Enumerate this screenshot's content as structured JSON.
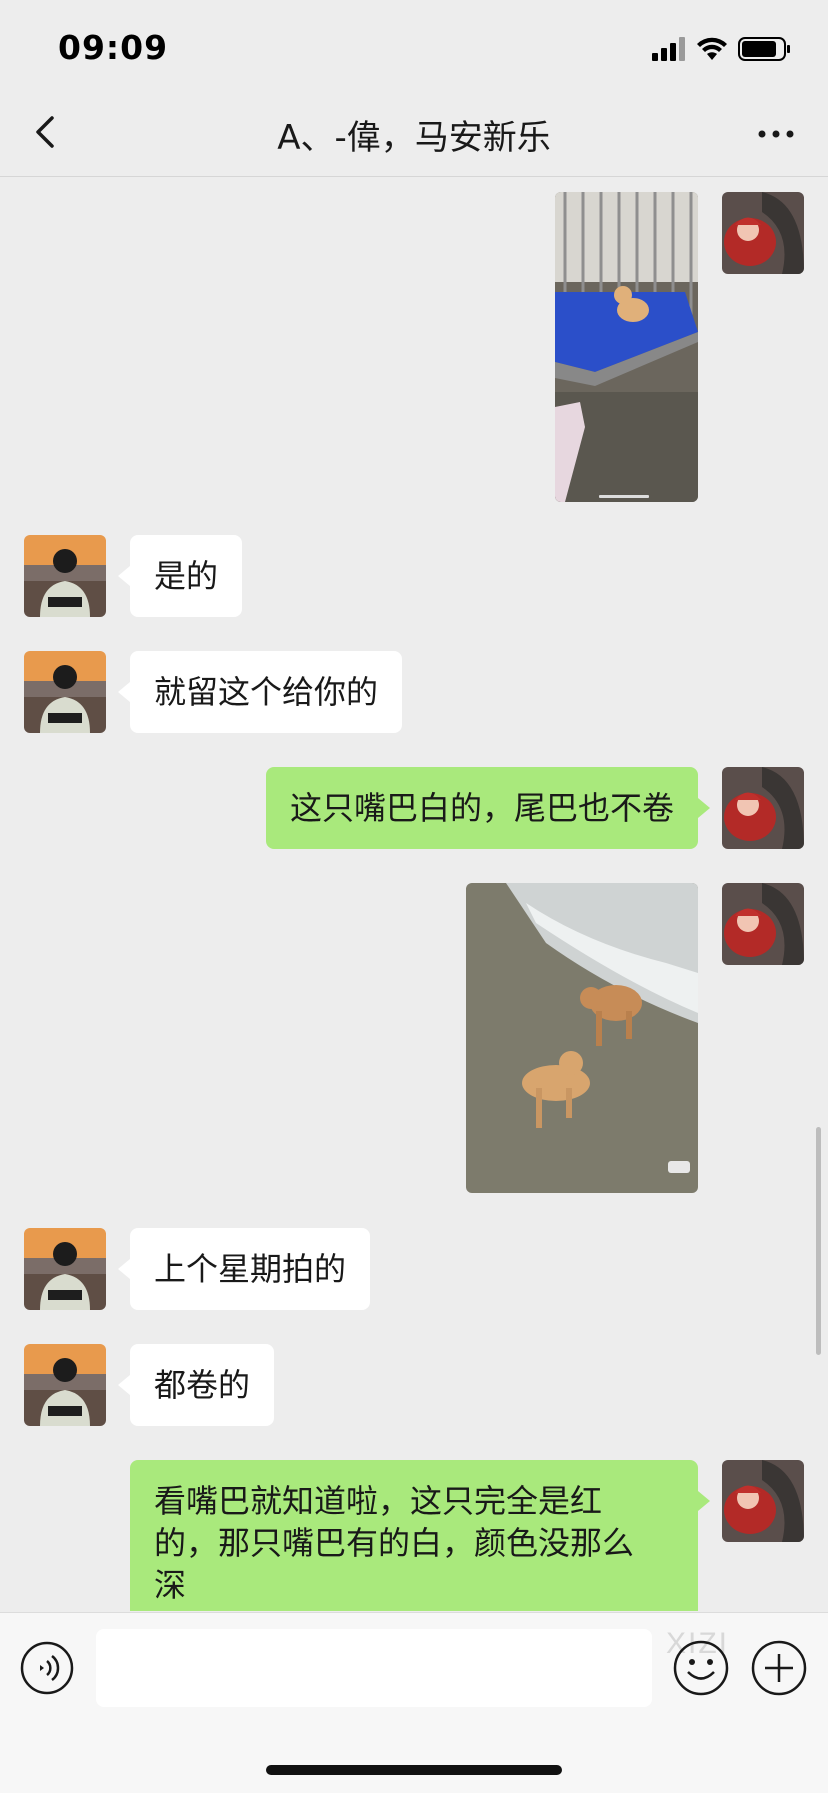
{
  "status": {
    "time": "09:09"
  },
  "nav": {
    "title": "A、-偉，马安新乐",
    "back_icon": "chevron-left-icon",
    "more_icon": "more-dots-icon"
  },
  "messages": [
    {
      "from": "me",
      "type": "image",
      "image_desc": "puppy-in-cage"
    },
    {
      "from": "them",
      "type": "text",
      "text": "是的"
    },
    {
      "from": "them",
      "type": "text",
      "text": "就留这个给你的"
    },
    {
      "from": "me",
      "type": "text",
      "text": "这只嘴巴白的，尾巴也不卷"
    },
    {
      "from": "me",
      "type": "image",
      "image_desc": "two-puppies-on-ground"
    },
    {
      "from": "them",
      "type": "text",
      "text": "上个星期拍的"
    },
    {
      "from": "them",
      "type": "text",
      "text": "都卷的"
    },
    {
      "from": "me",
      "type": "text",
      "lines": [
        "看嘴巴就知道啦，这只完全是红",
        "的，那只嘴巴有的白，颜色没那么",
        "深"
      ]
    }
  ],
  "input": {
    "value": "",
    "placeholder": "",
    "watermark": "XIZI"
  },
  "colors": {
    "background": "#ededed",
    "my_bubble": "#a9e97c",
    "their_bubble": "#ffffff"
  }
}
